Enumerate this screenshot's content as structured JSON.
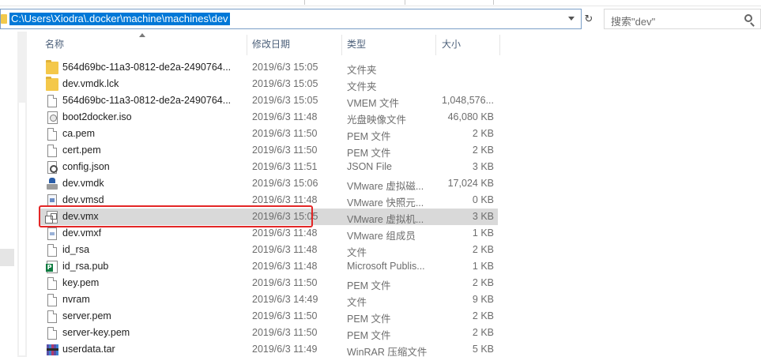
{
  "address_bar": {
    "path": "C:\\Users\\Xiodra\\.docker\\machine\\machines\\dev"
  },
  "search": {
    "placeholder": "搜索\"dev\""
  },
  "columns": {
    "name": "名称",
    "date": "修改日期",
    "type": "类型",
    "size": "大小"
  },
  "files": [
    {
      "name": "564d69bc-11a3-0812-de2a-2490764...",
      "date": "2019/6/3 15:05",
      "type": "文件夹",
      "size": "",
      "icon": "folder-icon"
    },
    {
      "name": "dev.vmdk.lck",
      "date": "2019/6/3 15:05",
      "type": "文件夹",
      "size": "",
      "icon": "folder-icon"
    },
    {
      "name": "564d69bc-11a3-0812-de2a-2490764...",
      "date": "2019/6/3 15:05",
      "type": "VMEM 文件",
      "size": "1,048,576...",
      "icon": "document-icon"
    },
    {
      "name": "boot2docker.iso",
      "date": "2019/6/3 11:48",
      "type": "光盘映像文件",
      "size": "46,080 KB",
      "icon": "disc-image-icon"
    },
    {
      "name": "ca.pem",
      "date": "2019/6/3 11:50",
      "type": "PEM 文件",
      "size": "2 KB",
      "icon": "document-icon"
    },
    {
      "name": "cert.pem",
      "date": "2019/6/3 11:50",
      "type": "PEM 文件",
      "size": "2 KB",
      "icon": "document-icon"
    },
    {
      "name": "config.json",
      "date": "2019/6/3 11:51",
      "type": "JSON File",
      "size": "3 KB",
      "icon": "settings-file-icon"
    },
    {
      "name": "dev.vmdk",
      "date": "2019/6/3 15:06",
      "type": "VMware 虚拟磁...",
      "size": "17,024 KB",
      "icon": "virtual-disk-icon"
    },
    {
      "name": "dev.vmsd",
      "date": "2019/6/3 11:48",
      "type": "VMware 快照元...",
      "size": "0 KB",
      "icon": "snapshot-file-icon"
    },
    {
      "name": "dev.vmx",
      "date": "2019/6/3 15:05",
      "type": "VMware 虚拟机...",
      "size": "3 KB",
      "icon": "vm-config-icon"
    },
    {
      "name": "dev.vmxf",
      "date": "2019/6/3 11:48",
      "type": "VMware 组成员",
      "size": "1 KB",
      "icon": "team-file-icon"
    },
    {
      "name": "id_rsa",
      "date": "2019/6/3 11:48",
      "type": "文件",
      "size": "2 KB",
      "icon": "document-icon"
    },
    {
      "name": "id_rsa.pub",
      "date": "2019/6/3 11:48",
      "type": "Microsoft Publis...",
      "size": "1 KB",
      "icon": "publisher-icon"
    },
    {
      "name": "key.pem",
      "date": "2019/6/3 11:50",
      "type": "PEM 文件",
      "size": "2 KB",
      "icon": "document-icon"
    },
    {
      "name": "nvram",
      "date": "2019/6/3 14:49",
      "type": "文件",
      "size": "9 KB",
      "icon": "document-icon"
    },
    {
      "name": "server.pem",
      "date": "2019/6/3 11:50",
      "type": "PEM 文件",
      "size": "2 KB",
      "icon": "document-icon"
    },
    {
      "name": "server-key.pem",
      "date": "2019/6/3 11:50",
      "type": "PEM 文件",
      "size": "2 KB",
      "icon": "document-icon"
    },
    {
      "name": "userdata.tar",
      "date": "2019/6/3 11:49",
      "type": "WinRAR 压缩文件",
      "size": "5 KB",
      "icon": "archive-icon"
    }
  ],
  "selected_index": 9,
  "colors": {
    "selection": "#0078d7",
    "highlight_border": "#e32626",
    "row_selected": "#d9d9d9"
  }
}
